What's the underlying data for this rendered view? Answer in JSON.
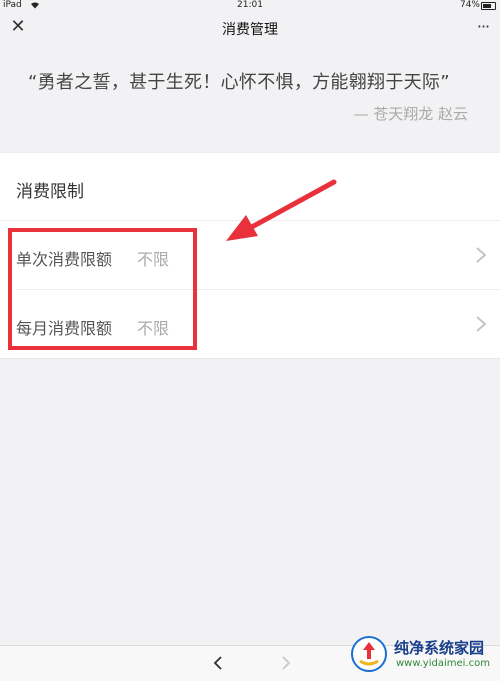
{
  "status_bar": {
    "device": "iPad",
    "time": "21:01",
    "battery": "74%"
  },
  "nav": {
    "title": "消费管理",
    "close_icon": "close-icon",
    "more_icon": "more-icon"
  },
  "quote": {
    "text": "“勇者之誓，甚于生死！心怀不惧，方能翱翔于天际”",
    "author": "— 苍天翔龙 赵云"
  },
  "limits": {
    "section_title": "消费限制",
    "rows": [
      {
        "label": "单次消费限额",
        "value": "不限"
      },
      {
        "label": "每月消费限额",
        "value": "不限"
      }
    ]
  },
  "annotation": {
    "color": "#e8313a"
  },
  "watermark": {
    "name": "纯净系统家园",
    "url": "www.yidaimei.com"
  },
  "colors": {
    "background": "#f2f2f4",
    "card": "#ffffff",
    "muted_text": "#aaaaaa"
  }
}
